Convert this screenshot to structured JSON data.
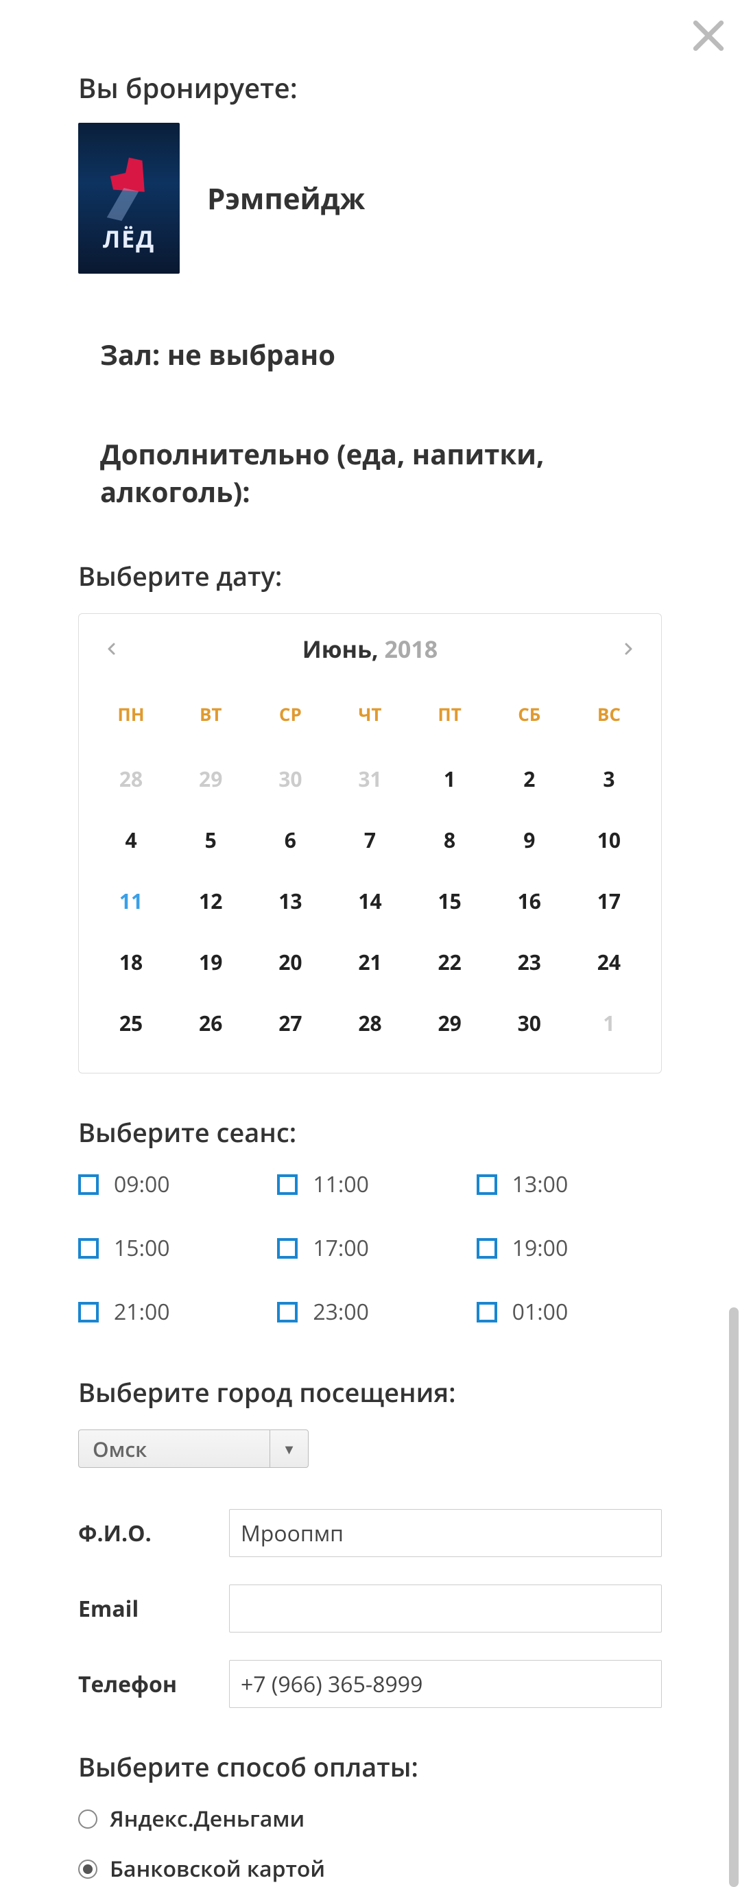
{
  "close_icon_name": "close-icon",
  "booking_title": "Вы бронируете:",
  "movie_title": "Рэмпейдж",
  "poster_text": "ЛЁД",
  "hall_label": "Зал:",
  "hall_value": "не выбрано",
  "extras_label": "Дополнительно (еда, напитки, алкоголь):",
  "select_date_title": "Выберите дату:",
  "calendar": {
    "month": "Июнь,",
    "year": "2018",
    "days_of_week": [
      "ПН",
      "ВТ",
      "СР",
      "ЧТ",
      "ПТ",
      "СБ",
      "ВС"
    ],
    "weeks": [
      [
        {
          "d": "28",
          "muted": true
        },
        {
          "d": "29",
          "muted": true
        },
        {
          "d": "30",
          "muted": true
        },
        {
          "d": "31",
          "muted": true
        },
        {
          "d": "1"
        },
        {
          "d": "2"
        },
        {
          "d": "3"
        }
      ],
      [
        {
          "d": "4"
        },
        {
          "d": "5"
        },
        {
          "d": "6"
        },
        {
          "d": "7"
        },
        {
          "d": "8"
        },
        {
          "d": "9"
        },
        {
          "d": "10"
        }
      ],
      [
        {
          "d": "11",
          "today": true
        },
        {
          "d": "12"
        },
        {
          "d": "13"
        },
        {
          "d": "14"
        },
        {
          "d": "15"
        },
        {
          "d": "16"
        },
        {
          "d": "17"
        }
      ],
      [
        {
          "d": "18"
        },
        {
          "d": "19"
        },
        {
          "d": "20"
        },
        {
          "d": "21"
        },
        {
          "d": "22"
        },
        {
          "d": "23"
        },
        {
          "d": "24"
        }
      ],
      [
        {
          "d": "25"
        },
        {
          "d": "26"
        },
        {
          "d": "27"
        },
        {
          "d": "28"
        },
        {
          "d": "29"
        },
        {
          "d": "30"
        },
        {
          "d": "1",
          "muted": true
        }
      ]
    ]
  },
  "select_session_title": "Выберите сеанс:",
  "sessions": [
    "09:00",
    "11:00",
    "13:00",
    "15:00",
    "17:00",
    "19:00",
    "21:00",
    "23:00",
    "01:00"
  ],
  "select_city_title": "Выберите город посещения:",
  "city_selected": "Омск",
  "form": {
    "fio_label": "Ф.И.О.",
    "fio_value": "Мроопмп",
    "email_label": "Email",
    "email_value": "",
    "phone_label": "Телефон",
    "phone_value": "+7 (966) 365-8999"
  },
  "select_payment_title": "Выберите способ оплаты:",
  "payment_options": [
    {
      "label": "Яндекс.Деньгами",
      "checked": false
    },
    {
      "label": "Банковской картой",
      "checked": true
    }
  ]
}
